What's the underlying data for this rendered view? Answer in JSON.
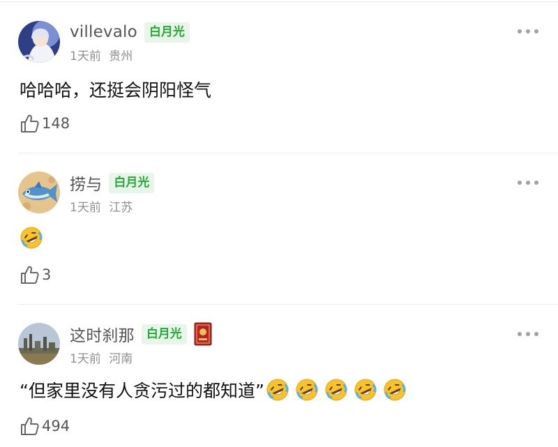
{
  "comments": [
    {
      "username": "villevalo",
      "badge": "白月光",
      "time": "1天前",
      "location": "贵州",
      "text": "哈哈哈，还挺会阴阳怪气",
      "emojis": [],
      "likes": "148",
      "avatar": "avatar-anime-boy"
    },
    {
      "username": "捞与",
      "badge": "白月光",
      "time": "1天前",
      "location": "江苏",
      "text": "",
      "emojis": [
        "rofl-emoji"
      ],
      "likes": "3",
      "avatar": "avatar-fish"
    },
    {
      "username": "这时刹那",
      "badge": "白月光",
      "time": "1天前",
      "location": "河南",
      "text": "“但家里没有人贪污过的都知道”",
      "emojis": [
        "rofl-emoji",
        "rofl-emoji",
        "rofl-emoji",
        "rofl-emoji",
        "rofl-emoji"
      ],
      "likes": "494",
      "avatar": "avatar-city"
    }
  ],
  "colors": {
    "badge_text": "#28a83a",
    "badge_bg": "#e8f6e9",
    "meta_text": "#8f8f8f",
    "divider": "#ececec"
  },
  "icons": [
    "more-icon",
    "like-icon",
    "red-medal-icon"
  ]
}
